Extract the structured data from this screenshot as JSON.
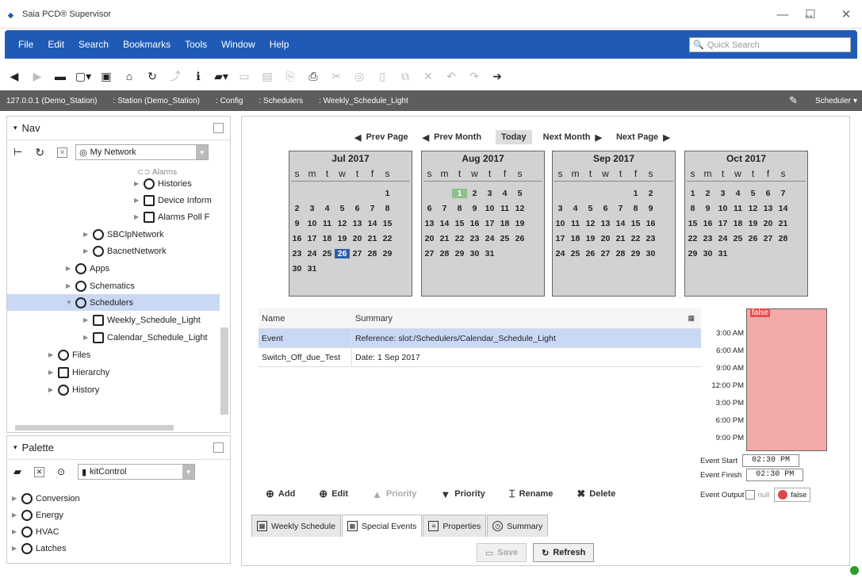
{
  "window": {
    "title": "Saia PCD® Supervisor"
  },
  "menu": [
    "File",
    "Edit",
    "Search",
    "Bookmarks",
    "Tools",
    "Window",
    "Help"
  ],
  "quick_search": {
    "placeholder": "Quick Search"
  },
  "path": [
    "127.0.0.1 (Demo_Station)",
    ": Station (Demo_Station)",
    ": Config",
    ": Schedulers",
    ": Weekly_Schedule_Light"
  ],
  "view_selector": "Scheduler",
  "nav": {
    "title": "Nav",
    "network": "My Network",
    "tree": [
      "Histories",
      "Device Inform",
      "Alarms Poll F",
      "SBClpNetwork",
      "BacnetNetwork",
      "Apps",
      "Schematics",
      "Schedulers",
      "Weekly_Schedule_Light",
      "Calendar_Schedule_Light",
      "Files",
      "Hierarchy",
      "History"
    ]
  },
  "palette": {
    "title": "Palette",
    "kit": "kitControl",
    "items": [
      "Conversion",
      "Energy",
      "HVAC",
      "Latches"
    ]
  },
  "cal_nav": {
    "prev_page": "Prev Page",
    "prev_month": "Prev Month",
    "today": "Today",
    "next_month": "Next Month",
    "next_page": "Next Page"
  },
  "weekdays": [
    "s",
    "m",
    "t",
    "w",
    "t",
    "f",
    "s"
  ],
  "calendars": [
    {
      "month": "Jul 2017",
      "rows": [
        [
          "",
          "",
          "",
          "",
          "",
          "",
          "1"
        ],
        [
          "2",
          "3",
          "4",
          "5",
          "6",
          "7",
          "8"
        ],
        [
          "9",
          "10",
          "11",
          "12",
          "13",
          "14",
          "15"
        ],
        [
          "16",
          "17",
          "18",
          "19",
          "20",
          "21",
          "22"
        ],
        [
          "23",
          "24",
          "25",
          "26",
          "27",
          "28",
          "29"
        ],
        [
          "30",
          "31",
          "",
          "",
          "",
          "",
          ""
        ]
      ],
      "today": "26"
    },
    {
      "month": "Aug 2017",
      "rows": [
        [
          "",
          "",
          "1",
          "2",
          "3",
          "4",
          "5"
        ],
        [
          "6",
          "7",
          "8",
          "9",
          "10",
          "11",
          "12"
        ],
        [
          "13",
          "14",
          "15",
          "16",
          "17",
          "18",
          "19"
        ],
        [
          "20",
          "21",
          "22",
          "23",
          "24",
          "25",
          "26"
        ],
        [
          "27",
          "28",
          "29",
          "30",
          "31",
          "",
          ""
        ]
      ],
      "green": "1"
    },
    {
      "month": "Sep 2017",
      "rows": [
        [
          "",
          "",
          "",
          "",
          "",
          "1",
          "2"
        ],
        [
          "3",
          "4",
          "5",
          "6",
          "7",
          "8",
          "9"
        ],
        [
          "10",
          "11",
          "12",
          "13",
          "14",
          "15",
          "16"
        ],
        [
          "17",
          "18",
          "19",
          "20",
          "21",
          "22",
          "23"
        ],
        [
          "24",
          "25",
          "26",
          "27",
          "28",
          "29",
          "30"
        ]
      ]
    },
    {
      "month": "Oct 2017",
      "rows": [
        [
          "1",
          "2",
          "3",
          "4",
          "5",
          "6",
          "7"
        ],
        [
          "8",
          "9",
          "10",
          "11",
          "12",
          "13",
          "14"
        ],
        [
          "15",
          "16",
          "17",
          "18",
          "19",
          "20",
          "21"
        ],
        [
          "22",
          "23",
          "24",
          "25",
          "26",
          "27",
          "28"
        ],
        [
          "29",
          "30",
          "31",
          "",
          "",
          "",
          ""
        ]
      ]
    }
  ],
  "events_table": {
    "headers": [
      "Name",
      "Summary"
    ],
    "rows": [
      {
        "name": "Event",
        "summary": "Reference: slot:/Schedulers/Calendar_Schedule_Light"
      },
      {
        "name": "Switch_Off_due_Test",
        "summary": "Date: 1 Sep 2017"
      }
    ]
  },
  "day_schedule": {
    "value_label": "false",
    "times": [
      "3:00 AM",
      "6:00 AM",
      "9:00 AM",
      "12:00 PM",
      "3:00 PM",
      "6:00 PM",
      "9:00 PM"
    ],
    "event_start_label": "Event Start",
    "event_start": "02:30 PM",
    "event_finish_label": "Event Finish",
    "event_finish": "02:30 PM",
    "event_output_label": "Event Output",
    "null_label": "null",
    "output_value": "false"
  },
  "actions": {
    "add": "Add",
    "edit": "Edit",
    "priority_up": "Priority",
    "priority_down": "Priority",
    "rename": "Rename",
    "delete": "Delete"
  },
  "tabs": [
    "Weekly Schedule",
    "Special Events",
    "Properties",
    "Summary"
  ],
  "buttons": {
    "save": "Save",
    "refresh": "Refresh"
  }
}
